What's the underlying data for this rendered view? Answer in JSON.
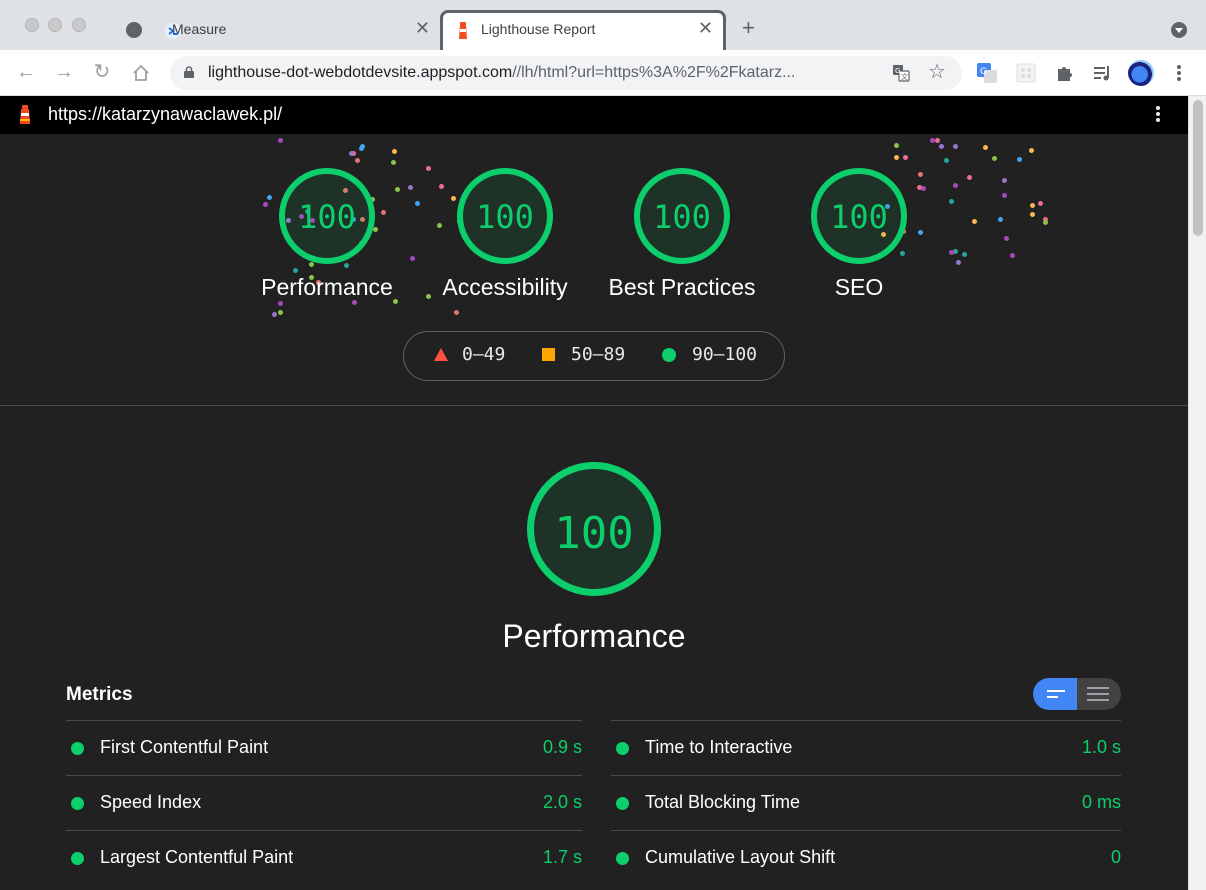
{
  "browser": {
    "tabs": [
      {
        "title": "Measure",
        "active": false
      },
      {
        "title": "Lighthouse Report",
        "active": true
      }
    ],
    "address": {
      "host": "lighthouse-dot-webdotdevsite.appspot.com",
      "path": "//lh/html?url=https%3A%2F%2Fkatarz..."
    }
  },
  "report": {
    "url": "https://katarzynawaclawek.pl/",
    "categories": [
      {
        "label": "Performance",
        "score": "100"
      },
      {
        "label": "Accessibility",
        "score": "100"
      },
      {
        "label": "Best Practices",
        "score": "100"
      },
      {
        "label": "SEO",
        "score": "100"
      }
    ],
    "legend": [
      {
        "range": "0–49",
        "color": "#ff4e42"
      },
      {
        "range": "50–89",
        "color": "#ffa400"
      },
      {
        "range": "90–100",
        "color": "#0cce6b"
      }
    ],
    "focus": {
      "label": "Performance",
      "score": "100"
    },
    "metrics_title": "Metrics",
    "metrics_left": [
      {
        "name": "First Contentful Paint",
        "value": "0.9 s"
      },
      {
        "name": "Speed Index",
        "value": "2.0 s"
      },
      {
        "name": "Largest Contentful Paint",
        "value": "1.7 s"
      }
    ],
    "metrics_right": [
      {
        "name": "Time to Interactive",
        "value": "1.0 s"
      },
      {
        "name": "Total Blocking Time",
        "value": "0 ms"
      },
      {
        "name": "Cumulative Layout Shift",
        "value": "0"
      }
    ],
    "pass_color": "#0cce6b"
  }
}
